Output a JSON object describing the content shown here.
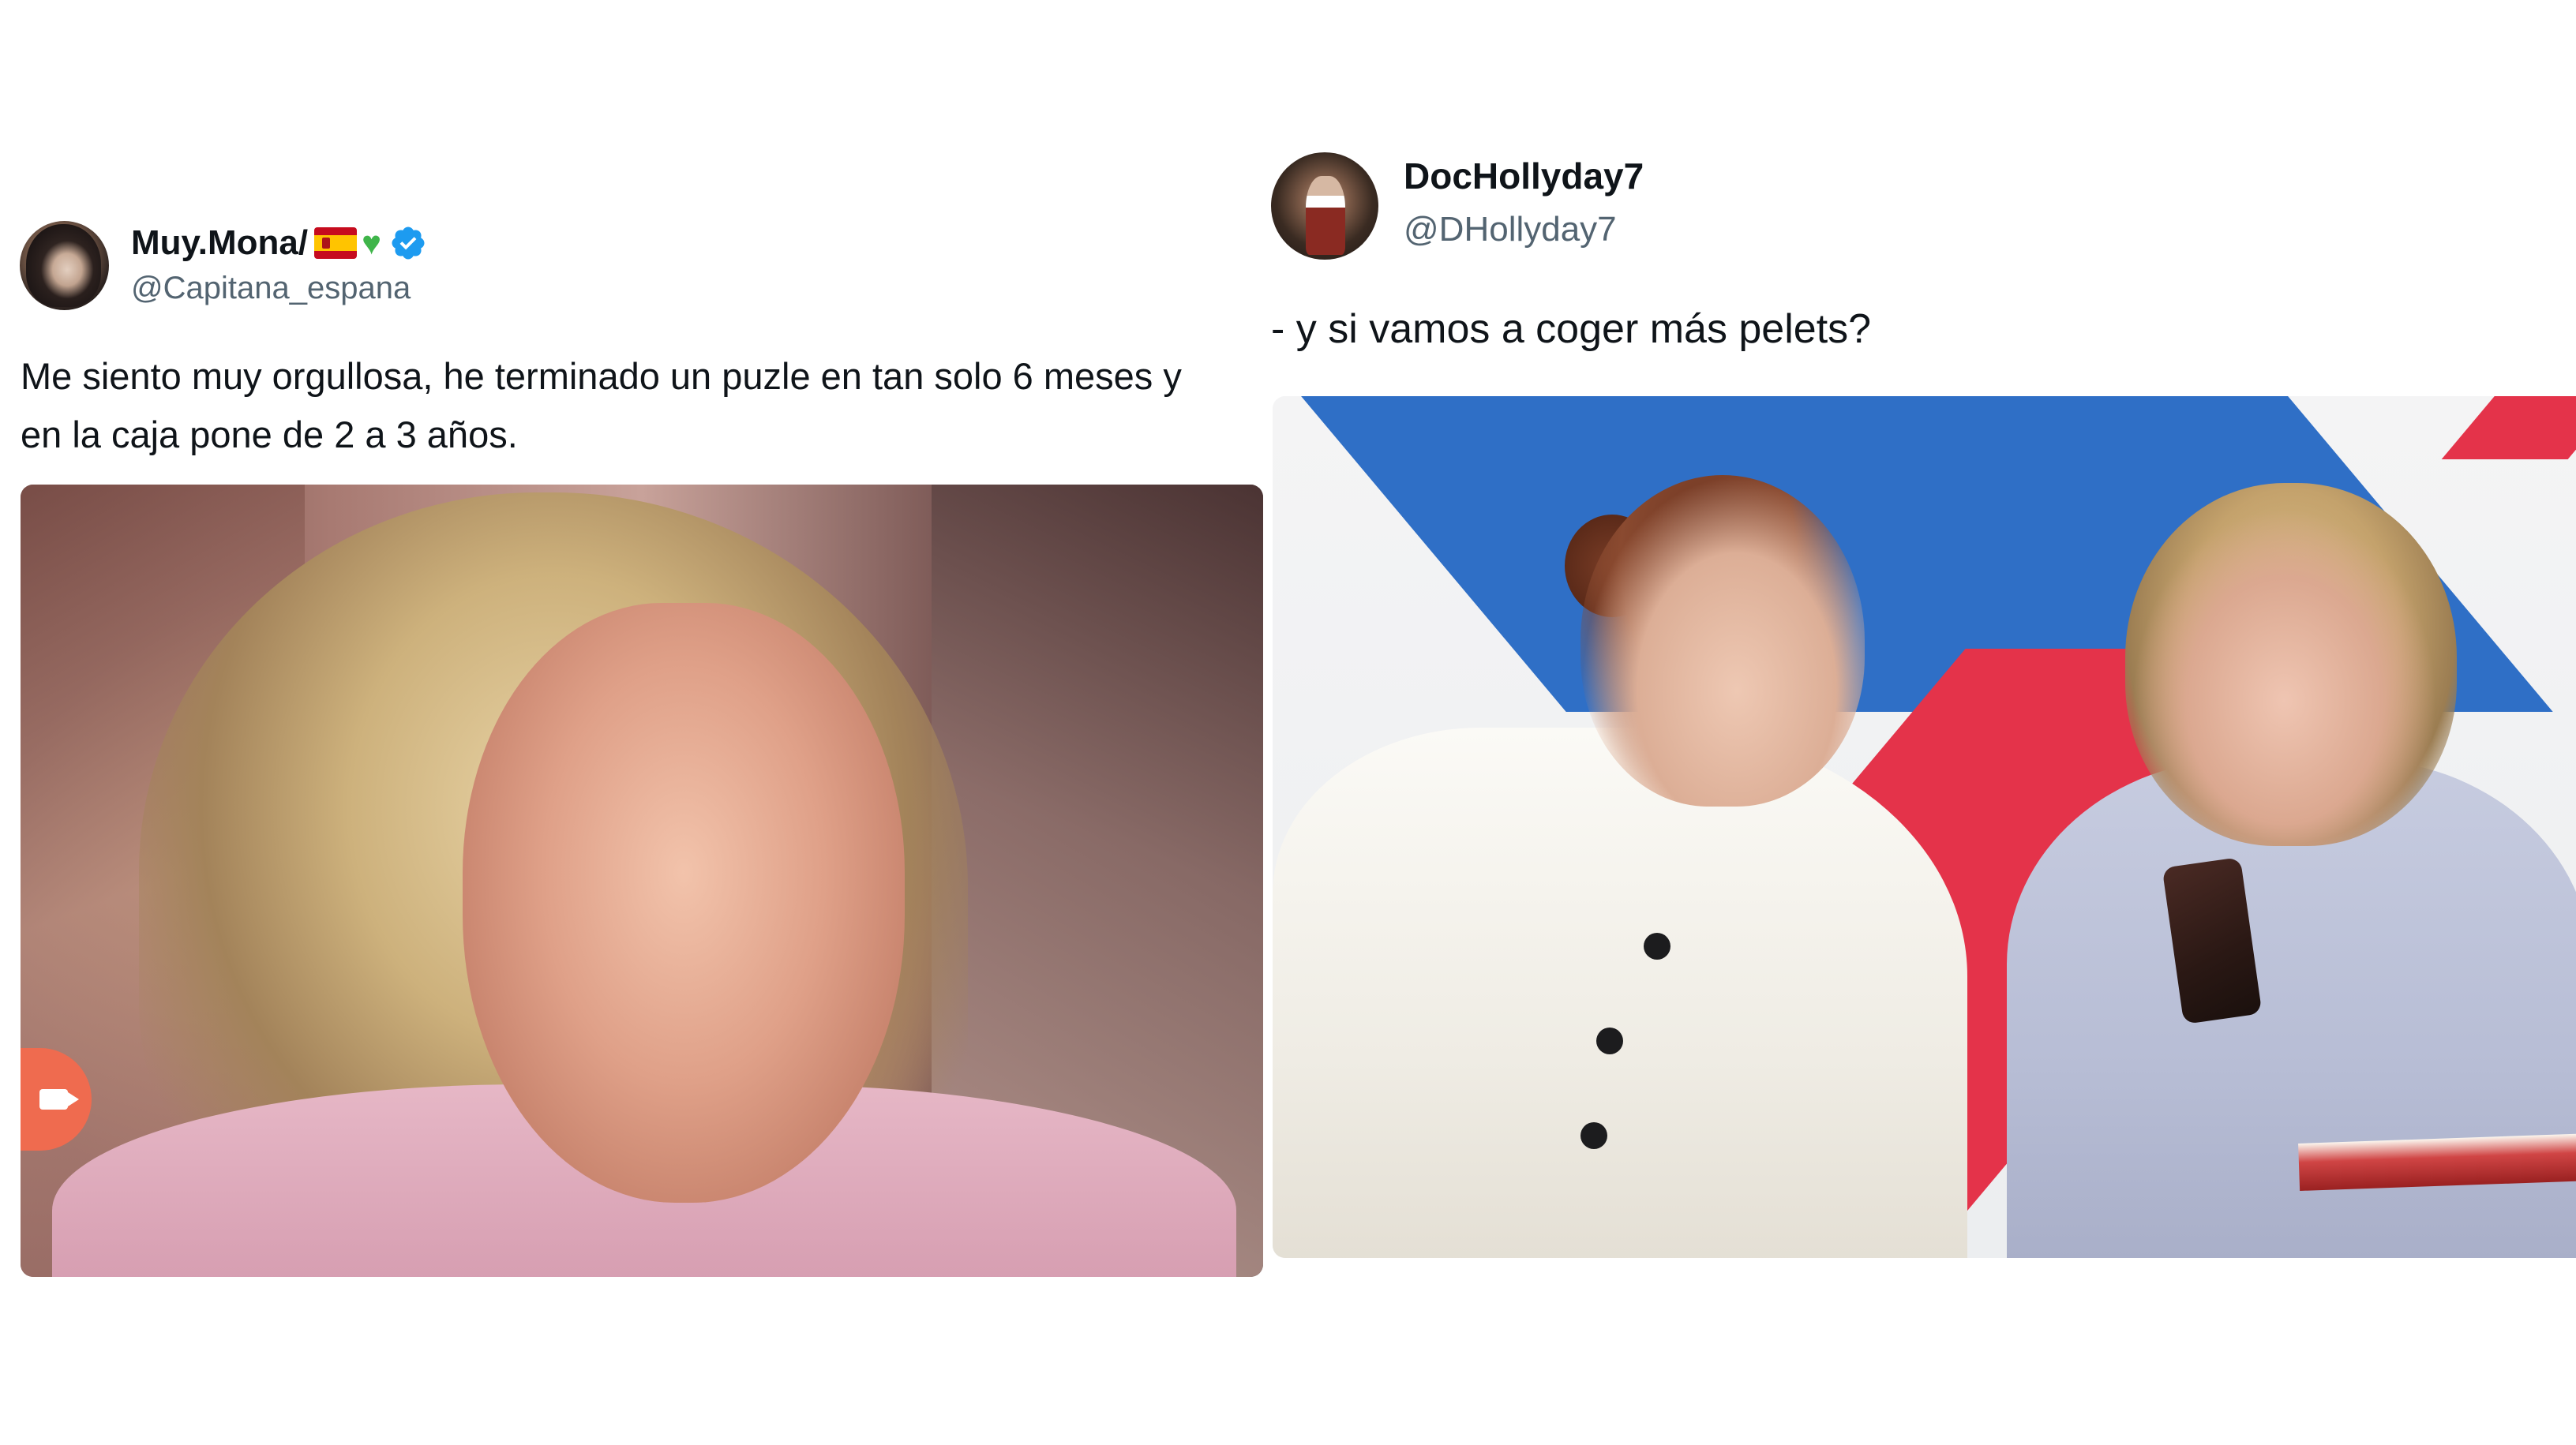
{
  "tweets": [
    {
      "display_name": "Muy.Mona/",
      "name_emojis": [
        "spain-flag-icon",
        "green-heart-icon"
      ],
      "verified": true,
      "handle": "@Capitana_espana",
      "text_lines": [
        "Me siento muy orgullosa, he terminado un puzle en tan solo 6 meses y",
        "en la caja pone de 2 a 3 años."
      ],
      "media": "photo of smiling blonde woman in pink sweater"
    },
    {
      "display_name": "DocHollyday7",
      "handle": "@DHollyday7",
      "text": "- y si vamos a coger más pelets?",
      "media": "photo of two women looking at a phone"
    }
  ],
  "colors": {
    "text_primary": "#0f1419",
    "text_secondary": "#536471",
    "verified_blue": "#1d9bf0",
    "heart_green": "#3fb54a"
  }
}
